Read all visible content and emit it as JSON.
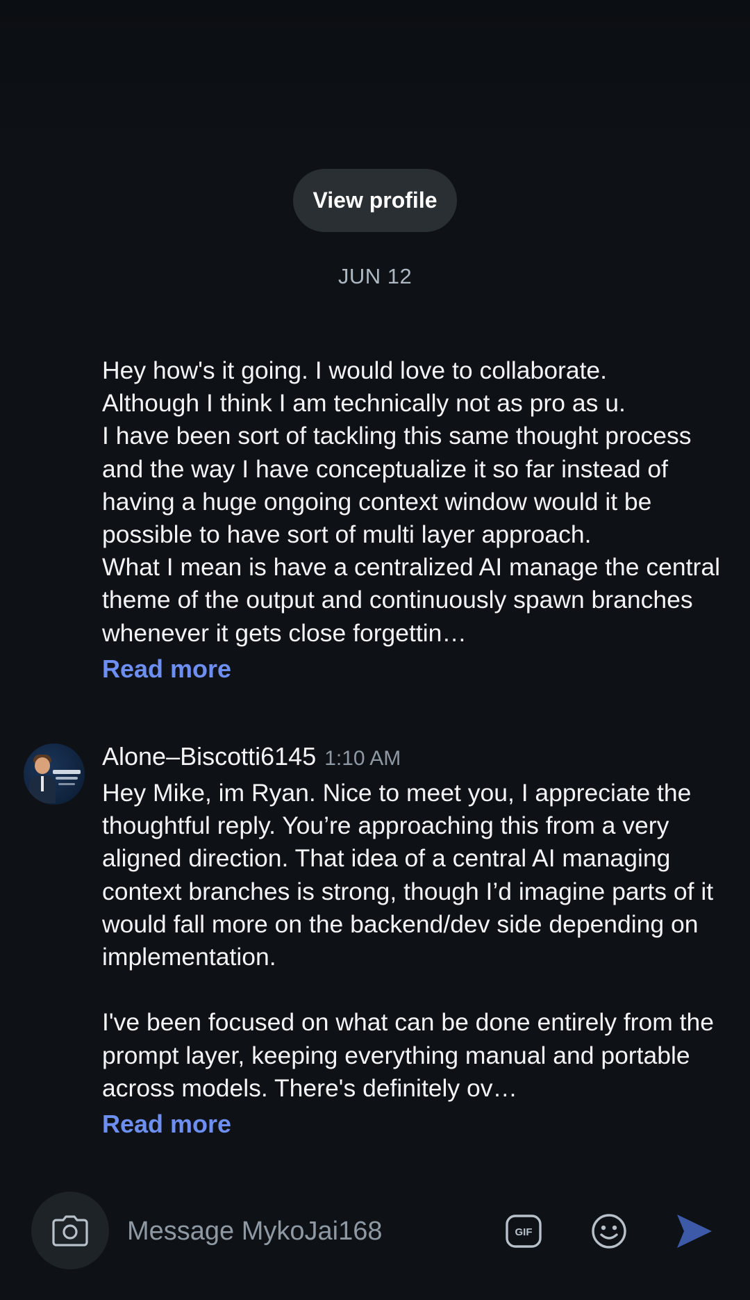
{
  "header": {
    "view_profile_label": "View profile"
  },
  "date_divider": "JUN 12",
  "messages": [
    {
      "body": "Hey how's it going. I would love to collaborate.\nAlthough I think I am technically not as pro as u.\nI have been sort of tackling this same thought process and the way I have conceptualize it so far instead of having a huge ongoing context window would it be possible to have sort of multi layer approach.\nWhat I mean is have a centralized AI manage the central theme of the output and continuously spawn branches whenever it gets close forgettin…",
      "read_more": "Read more"
    },
    {
      "author": "Alone–Biscotti6145",
      "time": "1:10 AM",
      "body": "Hey Mike, im Ryan. Nice to meet you, I appreciate the thoughtful reply. You’re approaching this from a very aligned direction. That idea of a central AI managing context branches is strong, though I’d imagine parts of it would fall more on the backend/dev side depending on implementation.\n\nI've been focused on what can be done entirely from the prompt layer, keeping everything manual and portable across models. There's definitely ov…",
      "read_more": "Read more"
    }
  ],
  "composer": {
    "placeholder": "Message MykoJai168",
    "icons": [
      "camera-icon",
      "gif-icon",
      "emoji-icon",
      "send-icon"
    ]
  },
  "colors": {
    "background": "#0e1216",
    "link": "#6e8ff2",
    "send": "#3c5aa8",
    "muted": "#8f99a3"
  }
}
